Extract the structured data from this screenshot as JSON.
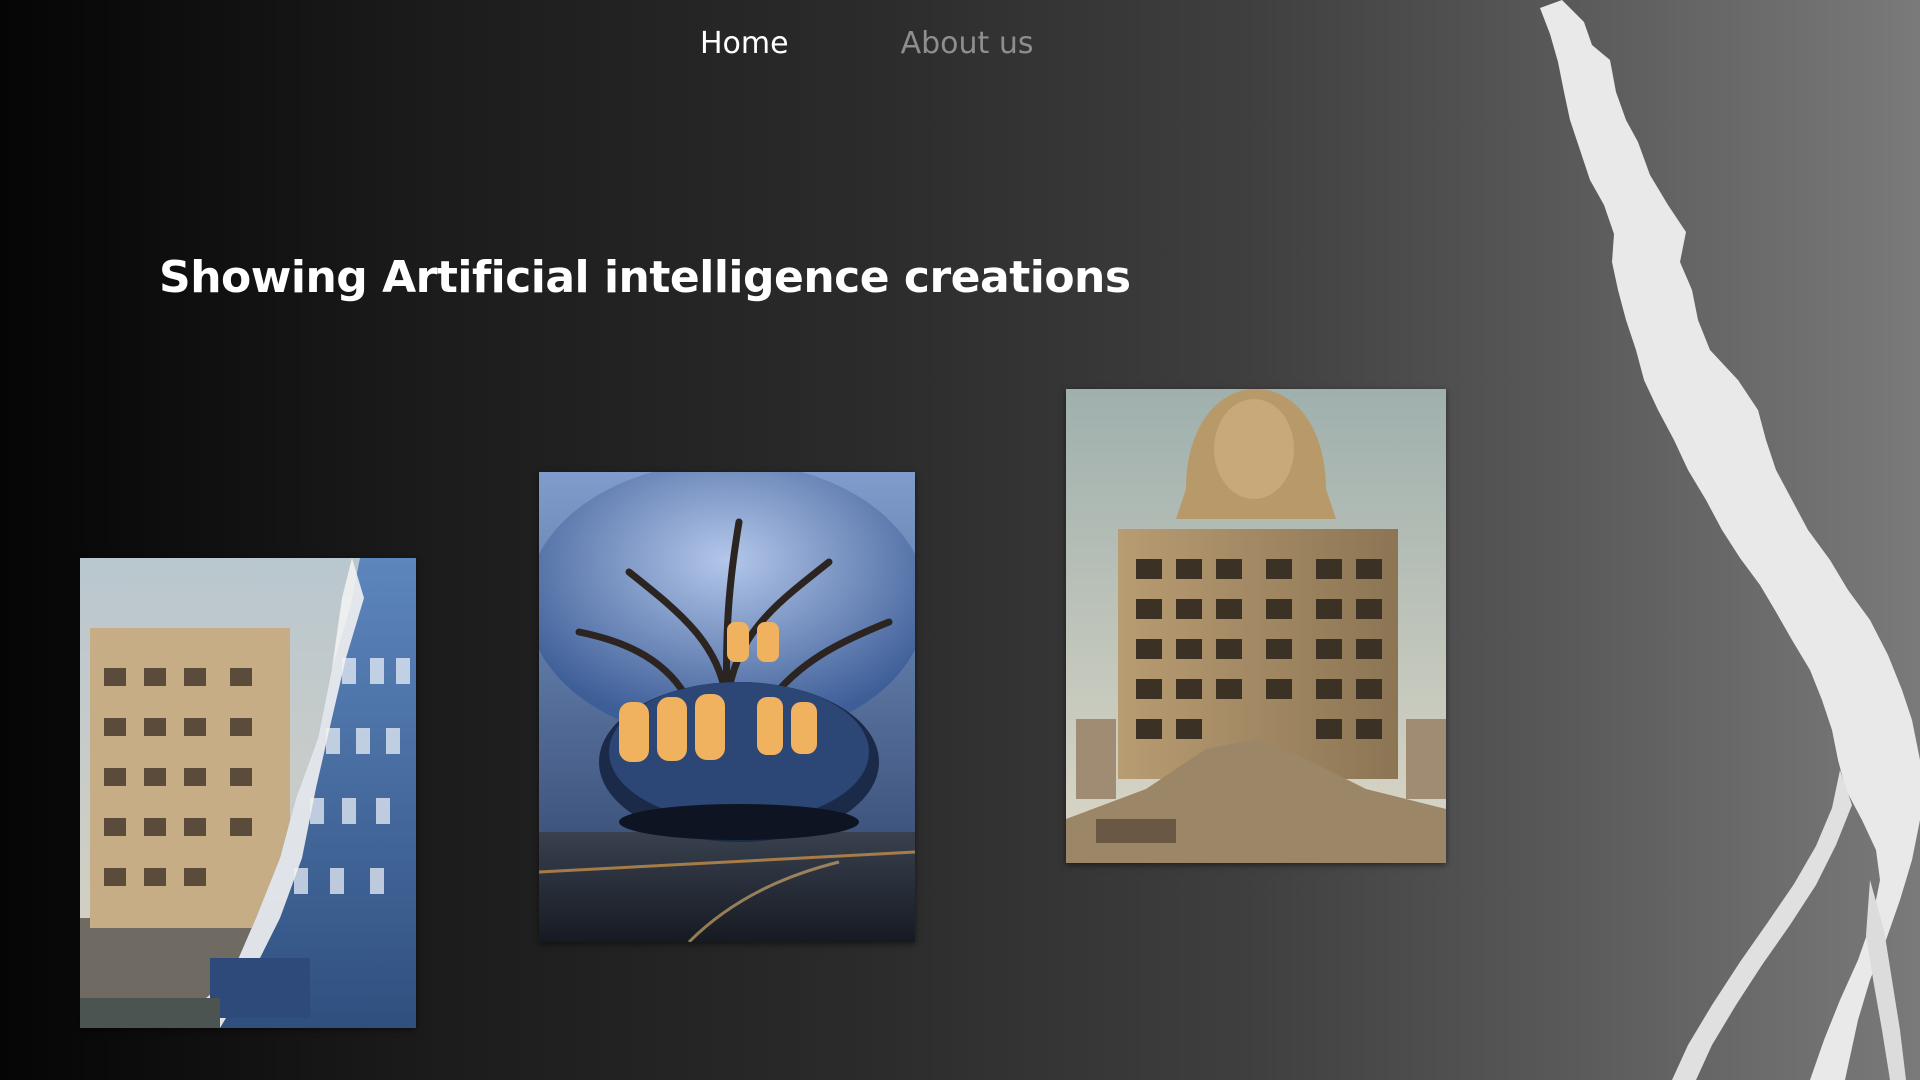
{
  "nav": {
    "home_label": "Home",
    "about_label": "About us"
  },
  "hero": {
    "title": "Showing Artificial intelligence creations"
  },
  "gallery": [
    {
      "icon": "torn-buildings-image"
    },
    {
      "icon": "tree-house-bus-image"
    },
    {
      "icon": "sphinx-ruined-building-image"
    }
  ],
  "colors": {
    "background_left": "#050505",
    "background_right": "#7a7a7a",
    "nav_active": "#ffffff",
    "nav_inactive": "#8e8e8e",
    "tear": "#ececec"
  }
}
